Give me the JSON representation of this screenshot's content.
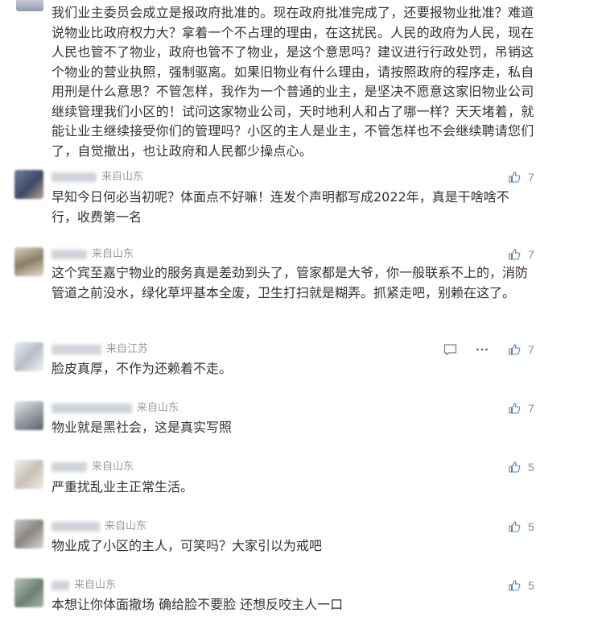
{
  "top_comment": {
    "text": "我们业主委员会成立是报政府批准的。现在政府批准完成了，还要报物业批准？难道说物业比政府权力大？拿着一个不占理的理由，在这扰民。人民的政府为人民，现在人民也管不了物业，政府也管不了物业，是这个意思吗？建议进行行政处罚，吊销这个物业的营业执照，强制驱离。如果旧物业有什么理由，请按照政府的程序走，私自用刑是什么意思？不管怎样，我作为一个普通的业主，是坚决不愿意这家旧物业公司继续管理我们小区的！试问这家物业公司，天时地利人和占了哪一样？天天堵着，就能让业主继续接受你们的管理吗？小区的主人是业主，不管怎样也不会继续聘请您们了，自觉撤出，也让政府和人民都少操点心。"
  },
  "comments": [
    {
      "location": "来自山东",
      "text": "早知今日何必当初呢？体面点不好嘛！连发个声明都写成2022年，真是干啥啥不行，收费第一名",
      "likes": "7"
    },
    {
      "location": "来自山东",
      "text": "这个宾至嘉宁物业的服务真是差劲到头了，管家都是大爷，你一般联系不上的，消防管道之前没水，绿化草坪基本全废，卫生打扫就是糊弄。抓紧走吧，别赖在这了。",
      "likes": "7"
    },
    {
      "location": "来自江苏",
      "text": "脸皮真厚，不作为还赖着不走。",
      "likes": "7"
    },
    {
      "location": "来自山东",
      "text": "物业就是黑社会，这是真实写照",
      "likes": "7"
    },
    {
      "location": "来自山东",
      "text": "严重扰乱业主正常生活。",
      "likes": "5"
    },
    {
      "location": "来自山东",
      "text": "物业成了小区的主人，可笑吗？大家引以为戒吧",
      "likes": "5"
    },
    {
      "location": "来自山东",
      "text": "本想让你体面撤场  确给脸不要脸  还想反咬主人一口",
      "likes": "5"
    }
  ],
  "icons": {
    "like": "thumbs-up-icon",
    "reply": "comment-icon",
    "more": "more-icon"
  },
  "colors": {
    "text": "#333333",
    "meta": "#999999",
    "icon": "#5b7fb6"
  }
}
